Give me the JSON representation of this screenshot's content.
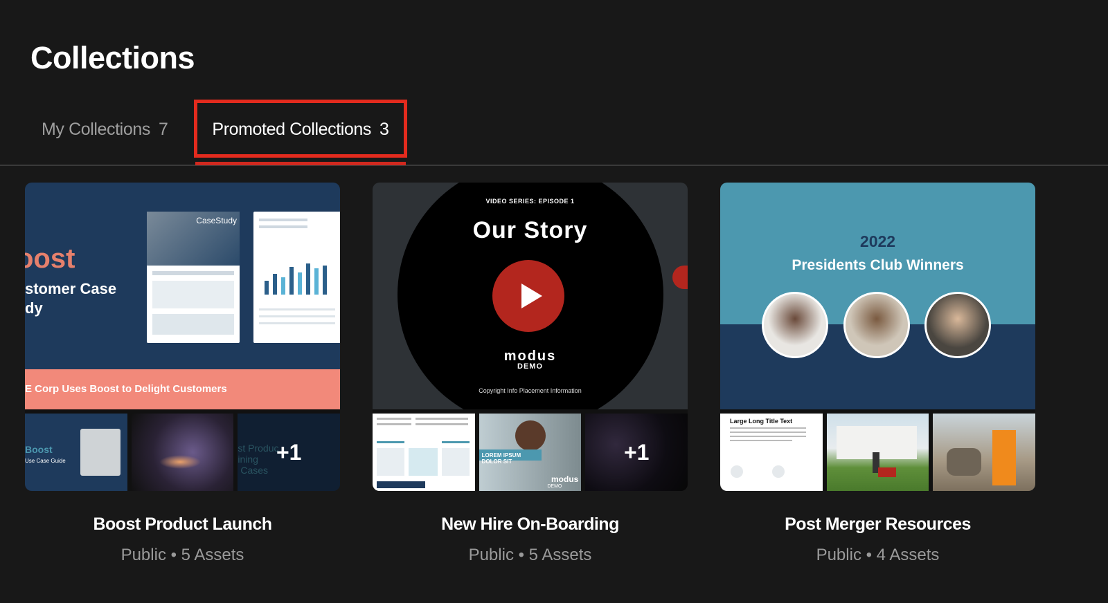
{
  "page": {
    "title": "Collections"
  },
  "tabs": [
    {
      "label": "My Collections",
      "count": "7"
    },
    {
      "label": "Promoted Collections",
      "count": "3"
    }
  ],
  "cards": [
    {
      "title": "Boost Product Launch",
      "meta": "Public • 5 Assets",
      "cover": {
        "headline": "oost",
        "subtitle_line1": "stomer Case",
        "subtitle_line2": "dy",
        "doc_label": "CaseStudy",
        "band_text": "E Corp Uses Boost to Delight Customers"
      },
      "minis": [
        {
          "text1": "Boost",
          "text2": "Use Case Guide"
        },
        {},
        {
          "text1": "st Produc",
          "text2": "ining",
          "text3": "Cases",
          "extra": "+1"
        }
      ]
    },
    {
      "title": "New Hire On-Boarding",
      "meta": "Public • 5 Assets",
      "cover": {
        "kicker": "VIDEO SERIES: EPISODE 1",
        "headline": "Our Story",
        "logo": "modus",
        "logo_sub": "DEMO",
        "copyright": "Copyright Info Placement Information"
      },
      "minis": [
        {},
        {
          "text1": "LOREM IPSUM DOLOR SIT",
          "text2": "modus",
          "text3": "DEMO"
        },
        {
          "extra": "+1"
        }
      ]
    },
    {
      "title": "Post Merger Resources",
      "meta": "Public • 4 Assets",
      "cover": {
        "year": "2022",
        "headline": "Presidents Club Winners"
      },
      "minis": [
        {
          "text1": "Large Long Title Text"
        },
        {},
        {}
      ]
    }
  ],
  "colors": {
    "accent": "#e32b1e",
    "background": "#181818",
    "muted": "#9a9a9a"
  }
}
